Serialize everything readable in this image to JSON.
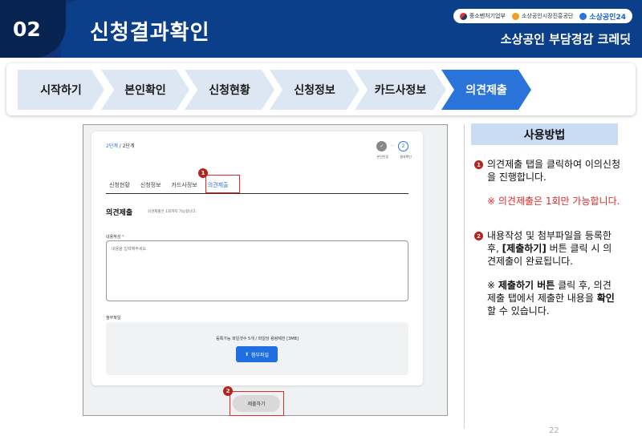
{
  "header": {
    "section_num": "02",
    "title": "신청결과확인",
    "logos": [
      "중소벤처기업부",
      "소상공인시장진흥공단",
      "소상공인24"
    ],
    "program": "소상공인 부담경감 크레딧"
  },
  "steps": [
    "시작하기",
    "본인확인",
    "신청현황",
    "신청정보",
    "카드사정보",
    "의견제출"
  ],
  "active_step": "의견제출",
  "form": {
    "step_count_current": "2단계",
    "step_count_total": " / 2단계",
    "mini_step_done": "✓",
    "mini_step_cur": "2",
    "mini_step_labels": [
      "본인인증",
      "결과확인"
    ],
    "tabs": [
      "신청현황",
      "신청정보",
      "카드사정보",
      "의견제출"
    ],
    "section_title": "의견제출",
    "section_note": "의견제출은 1회까지 가능합니다.",
    "content_label": "내용작성",
    "content_required": "*",
    "content_placeholder": "내용을 입력해주세요.",
    "file_label": "첨부파일",
    "file_info": "등록가능 파일갯수 5개 / 파일당 용량제한 [3MB]",
    "attach_button": "첨부파일",
    "submit_button": "제출하기"
  },
  "callouts": [
    "1",
    "2"
  ],
  "usage": {
    "title": "사용방법",
    "step1": "의견제출 탭을 클릭하여 이의신청을 진행합니다.",
    "step1_note": "※ 의견제출은 1회만 가능합니다.",
    "step2_pre": "내용작성 및 첨부파일을 등록한 후, ",
    "step2_bold": "[제출하기]",
    "step2_post": " 버튼 클릭 시 의견제출이 완료됩니다.",
    "note_pre": "※ ",
    "note_bold": "제출하기 버튼",
    "note_mid": " 클릭 후, 의견제출 탭에서 제출한 내용을 ",
    "note_bold2": "확인",
    "note_post": "할 수 있습니다."
  },
  "page_number": "22",
  "colors": {
    "header_navy": "#0c3f8a",
    "active_step": "#2a73d9",
    "inactive_step": "#dde7f3",
    "highlight_red": "#e02a2a"
  }
}
